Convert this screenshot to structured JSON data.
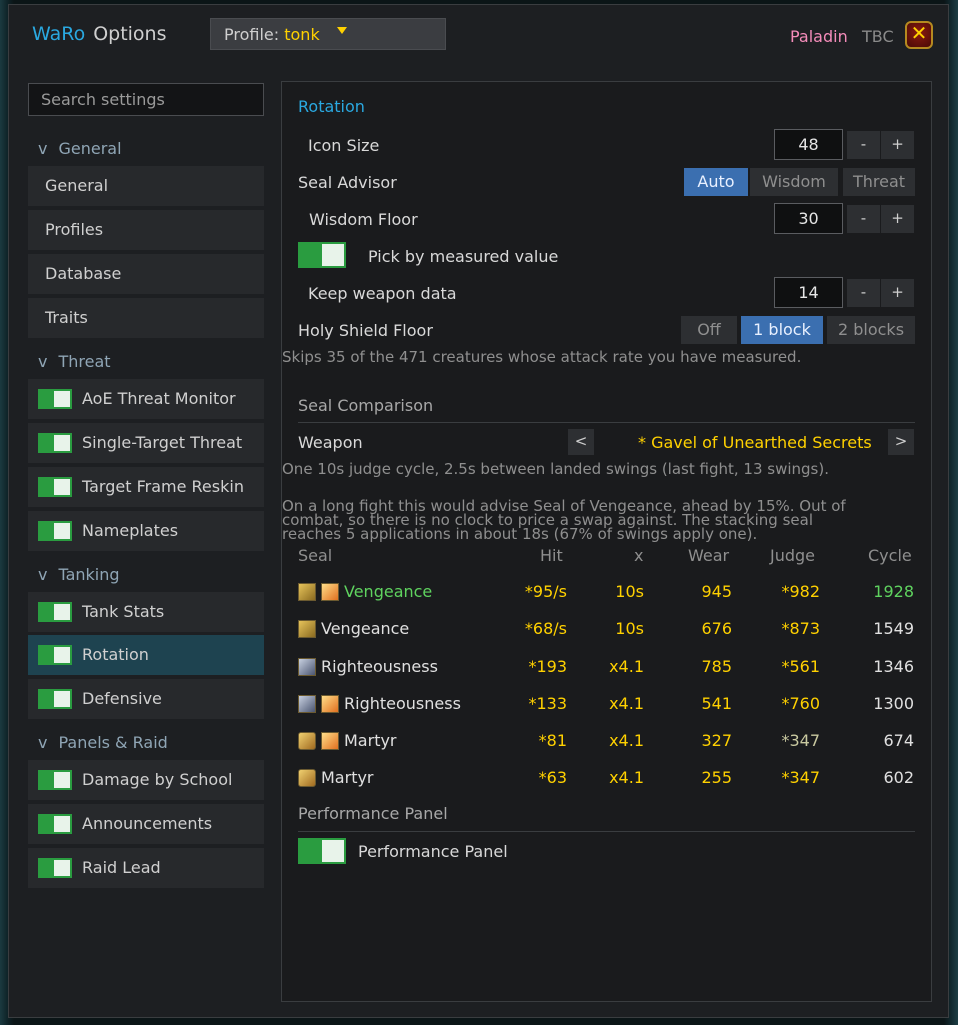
{
  "header": {
    "app_name": "WaRo",
    "title": "Options",
    "profile_prefix": "Profile:",
    "profile_value": "tonk",
    "class_label": "Paladin",
    "version_label": "TBC",
    "close_glyph": "✕"
  },
  "sidebar": {
    "search_placeholder": "Search settings",
    "collapse_glyph": "v",
    "sections": {
      "general": {
        "title": "General",
        "items": [
          "General",
          "Profiles",
          "Database",
          "Traits"
        ]
      },
      "threat": {
        "title": "Threat",
        "items": [
          "AoE Threat Monitor",
          "Single-Target Threat",
          "Target Frame Reskin",
          "Nameplates"
        ]
      },
      "tanking": {
        "title": "Tanking",
        "items": [
          "Tank Stats",
          "Rotation",
          "Defensive"
        ]
      },
      "panels": {
        "title": "Panels & Raid",
        "items": [
          "Damage by School",
          "Announcements",
          "Raid Lead"
        ]
      }
    },
    "selected": "Rotation"
  },
  "rotation": {
    "title": "Rotation",
    "icon_size_label": "Icon Size",
    "icon_size_value": "48",
    "seal_advisor_label": "Seal Advisor",
    "seal_advisor_options": [
      "Auto",
      "Wisdom",
      "Threat"
    ],
    "seal_advisor_selected": "Auto",
    "wisdom_floor_label": "Wisdom Floor",
    "wisdom_floor_value": "30",
    "pick_by_measured_label": "Pick by measured value",
    "pick_by_measured_on": true,
    "keep_weapon_label": "Keep weapon data",
    "keep_weapon_value": "14",
    "holy_shield_label": "Holy Shield Floor",
    "holy_shield_options": [
      "Off",
      "1 block",
      "2 blocks"
    ],
    "holy_shield_selected": "1 block",
    "holy_shield_hint": "Skips 35 of the 471 creatures whose attack rate you have measured.",
    "minus": "-",
    "plus": "+"
  },
  "seal_comparison": {
    "title": "Seal Comparison",
    "weapon_label": "Weapon",
    "prev": "<",
    "next": ">",
    "weapon_value": "* Gavel of Unearthed Secrets",
    "cycle_hint": "One 10s judge cycle, 2.5s between landed swings (last fight, 13 swings).",
    "advice_line1": "On a long fight this would advise Seal of Vengeance, ahead by 15%.  Out of",
    "advice_line2": "combat, so there is no clock to price a swap against.  The stacking seal",
    "advice_line3": "reaches 5 applications in about 18s (67% of swings apply one).",
    "columns": [
      "Seal",
      "Hit",
      "x",
      "Wear",
      "Judge",
      "Cycle"
    ],
    "rows": [
      {
        "seal": "Vengeance",
        "hit": "*95/s",
        "x": "10s",
        "wear": "945",
        "judge": "*982",
        "cycle": "1928"
      },
      {
        "seal": "Vengeance",
        "hit": "*68/s",
        "x": "10s",
        "wear": "676",
        "judge": "*873",
        "cycle": "1549"
      },
      {
        "seal": "Righteousness",
        "hit": "*193",
        "x": "x4.1",
        "wear": "785",
        "judge": "*561",
        "cycle": "1346"
      },
      {
        "seal": "Righteousness",
        "hit": "*133",
        "x": "x4.1",
        "wear": "541",
        "judge": "*760",
        "cycle": "1300"
      },
      {
        "seal": "Martyr",
        "hit": "*81",
        "x": "x4.1",
        "wear": "327",
        "judge": "*347",
        "cycle": "674"
      },
      {
        "seal": "Martyr",
        "hit": "*63",
        "x": "x4.1",
        "wear": "255",
        "judge": "*347",
        "cycle": "602"
      }
    ]
  },
  "performance": {
    "title": "Performance Panel",
    "toggle_label": "Performance Panel",
    "toggle_on": true
  },
  "colors": {
    "accent": "#2aa8e0",
    "gold": "#ffd100",
    "paladin": "#f48cba",
    "toggle_on": "#2a9c40",
    "segment_on": "#3b6fb0",
    "best_row": "#5fd35f"
  }
}
